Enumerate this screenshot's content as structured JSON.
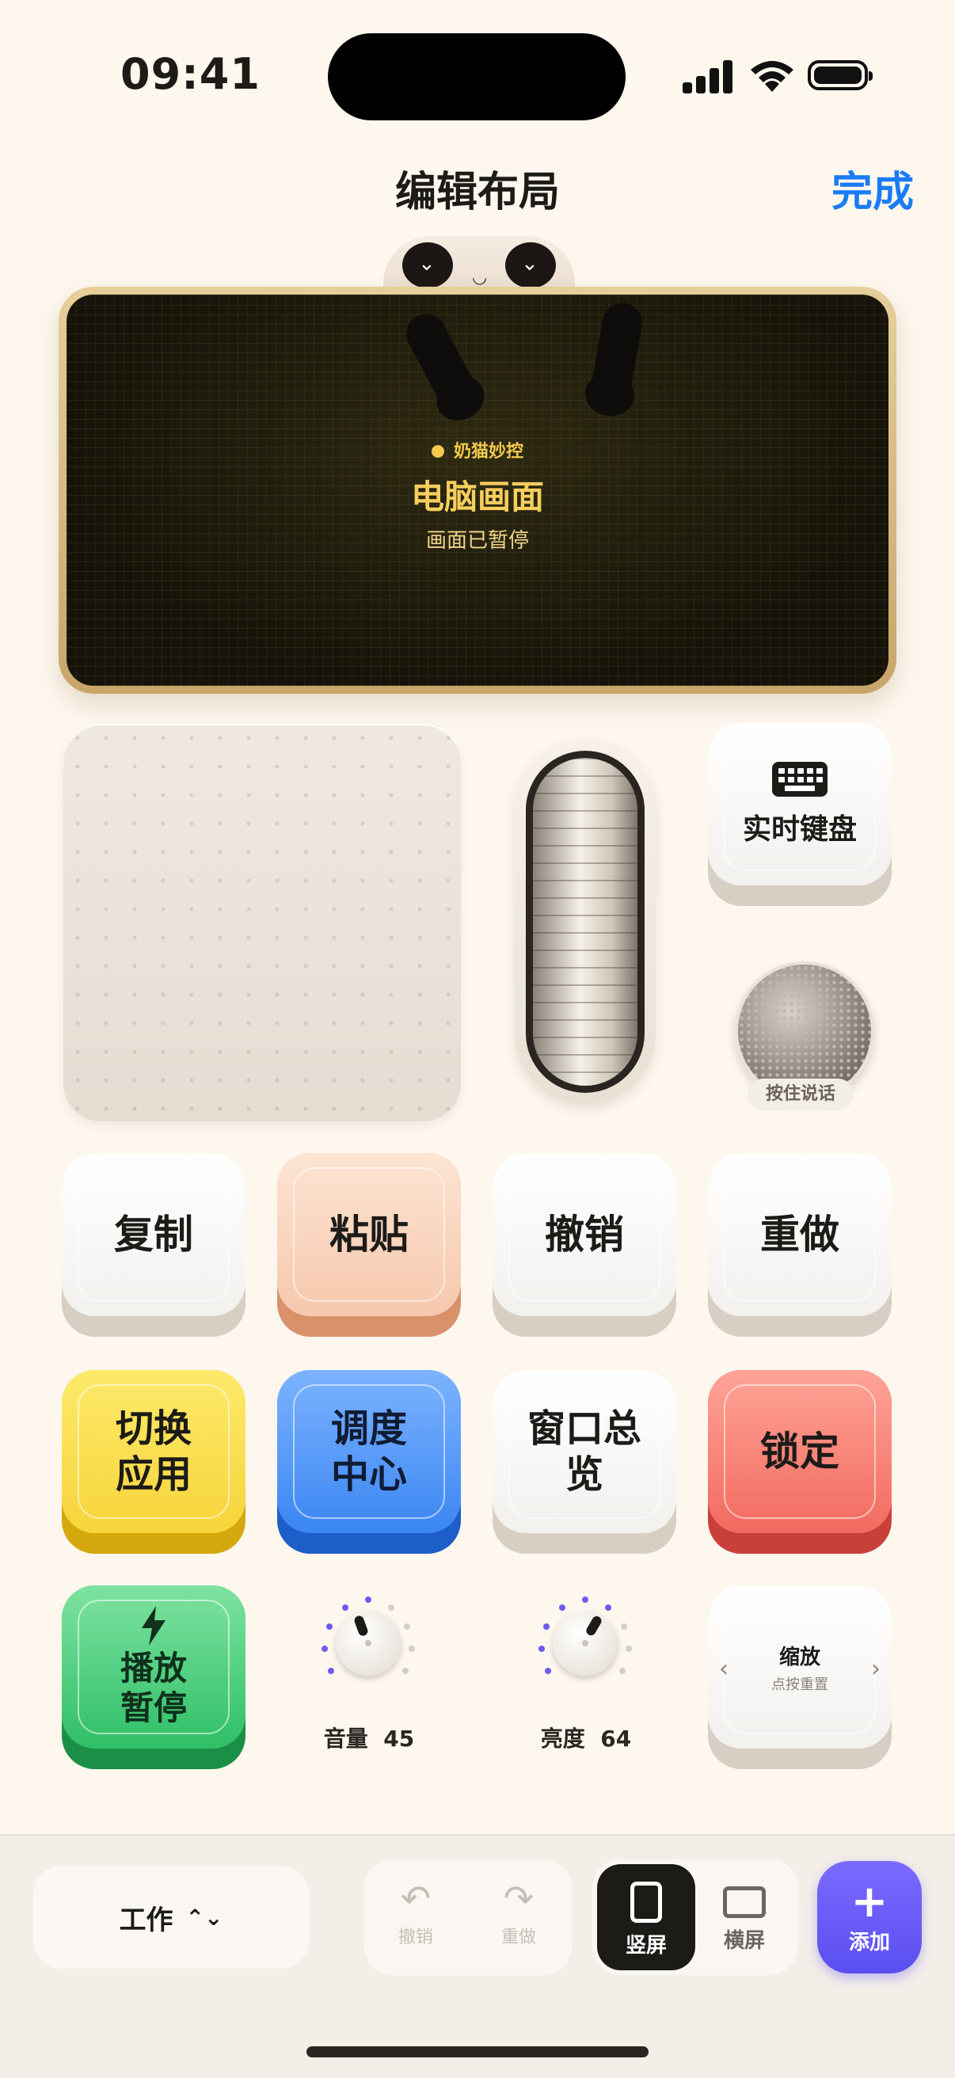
{
  "status_bar": {
    "time": "09:41"
  },
  "nav": {
    "title": "编辑布局",
    "done_label": "完成"
  },
  "screen_panel": {
    "brand": "奶猫妙控",
    "title": "电脑画面",
    "subtitle": "画面已暂停"
  },
  "controls": {
    "keyboard_label": "实时键盘",
    "mic_label": "按住说话"
  },
  "keys": {
    "copy": "复制",
    "paste": "粘贴",
    "undo": "撤销",
    "redo": "重做",
    "switch_app_line1": "切换",
    "switch_app_line2": "应用",
    "mission_line1": "调度",
    "mission_line2": "中心",
    "expose_line1": "窗口总",
    "expose_line2": "览",
    "lock": "锁定",
    "play_line1": "播放",
    "play_line2": "暂停"
  },
  "knobs": {
    "volume": {
      "label": "音量",
      "value": "45"
    },
    "brightness": {
      "label": "亮度",
      "value": "64"
    }
  },
  "zoom": {
    "title": "缩放",
    "subtitle": "点按重置"
  },
  "bottom_bar": {
    "profile": "工作",
    "undo_label": "撤销",
    "redo_label": "重做",
    "portrait_label": "竖屏",
    "landscape_label": "横屏",
    "add_label": "添加"
  },
  "colors": {
    "accent_blue": "#1a7cf5",
    "add_purple": "#6a5cf7",
    "screen_gold": "#f6cf5c",
    "knob_tick_active": "#6b5cf0"
  }
}
